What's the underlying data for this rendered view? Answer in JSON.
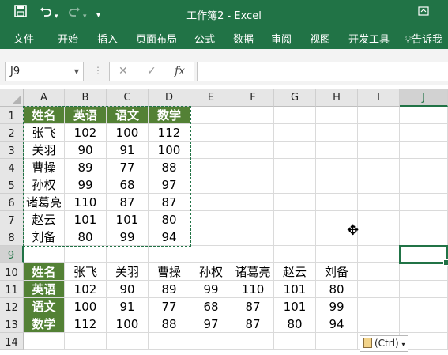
{
  "app": {
    "title": "工作簿2 - Excel",
    "save_icon": "save-icon",
    "undo_icon": "undo-icon",
    "redo_icon": "redo-icon",
    "customize_icon": "customize-quick-access-icon",
    "restore_icon": "ribbon-display-options-icon"
  },
  "ribbon": {
    "tabs": [
      "文件",
      "开始",
      "插入",
      "页面布局",
      "公式",
      "数据",
      "审阅",
      "视图",
      "开发工具"
    ],
    "tell_me": "告诉我"
  },
  "formula_bar": {
    "name_box": "J9",
    "cancel_glyph": "✕",
    "enter_glyph": "✓",
    "fx_glyph": "fx",
    "value": ""
  },
  "sheet": {
    "columns": [
      "A",
      "B",
      "C",
      "D",
      "E",
      "F",
      "G",
      "H",
      "I",
      "J"
    ],
    "rows": [
      "1",
      "2",
      "3",
      "4",
      "5",
      "6",
      "7",
      "8",
      "9",
      "10",
      "11",
      "12",
      "13",
      "14"
    ],
    "selected_cell": "J9",
    "copy_range": "A1:D8",
    "cells": [
      [
        "姓名",
        "英语",
        "语文",
        "数学",
        "",
        "",
        "",
        "",
        "",
        ""
      ],
      [
        "张飞",
        "102",
        "100",
        "112",
        "",
        "",
        "",
        "",
        "",
        ""
      ],
      [
        "关羽",
        "90",
        "91",
        "100",
        "",
        "",
        "",
        "",
        "",
        ""
      ],
      [
        "曹操",
        "89",
        "77",
        "88",
        "",
        "",
        "",
        "",
        "",
        ""
      ],
      [
        "孙权",
        "99",
        "68",
        "97",
        "",
        "",
        "",
        "",
        "",
        ""
      ],
      [
        "诸葛亮",
        "110",
        "87",
        "87",
        "",
        "",
        "",
        "",
        "",
        ""
      ],
      [
        "赵云",
        "101",
        "101",
        "80",
        "",
        "",
        "",
        "",
        "",
        ""
      ],
      [
        "刘备",
        "80",
        "99",
        "94",
        "",
        "",
        "",
        "",
        "",
        ""
      ],
      [
        "",
        "",
        "",
        "",
        "",
        "",
        "",
        "",
        "",
        ""
      ],
      [
        "姓名",
        "张飞",
        "关羽",
        "曹操",
        "孙权",
        "诸葛亮",
        "赵云",
        "刘备",
        "",
        ""
      ],
      [
        "英语",
        "102",
        "90",
        "89",
        "99",
        "110",
        "101",
        "80",
        "",
        ""
      ],
      [
        "语文",
        "100",
        "91",
        "77",
        "68",
        "87",
        "101",
        "99",
        "",
        ""
      ],
      [
        "数学",
        "112",
        "100",
        "88",
        "97",
        "87",
        "80",
        "94",
        "",
        ""
      ],
      [
        "",
        "",
        "",
        "",
        "",
        "",
        "",
        "",
        "",
        ""
      ]
    ],
    "header_cells": [
      "A1",
      "B1",
      "C1",
      "D1",
      "A10",
      "A11",
      "A12",
      "A13"
    ],
    "header_fill": "#538135"
  },
  "paste_options": {
    "label": "(Ctrl)",
    "icon": "paste-clipboard-icon"
  },
  "colors": {
    "excel_green": "#217346",
    "header_fill": "#538135"
  }
}
